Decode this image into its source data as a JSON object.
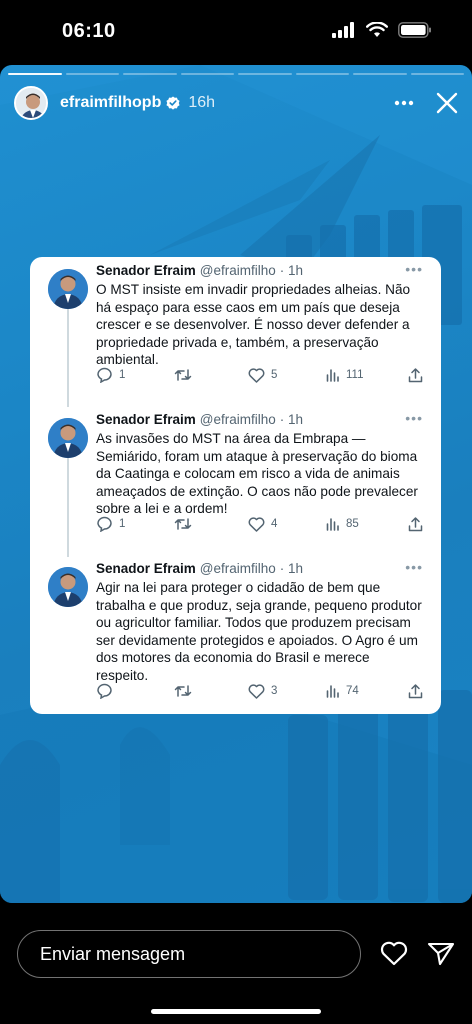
{
  "status": {
    "time": "06:10"
  },
  "story": {
    "username": "efraimfilhopb",
    "time_ago": "16h",
    "segments_total": 8,
    "segments_done": 1
  },
  "tweets": [
    {
      "name": "Senador Efraim",
      "handle": "@efraimfilho",
      "meta": "· 1h",
      "text": "O MST insiste em invadir propriedades alheias. Não há espaço para esse caos em um país que deseja crescer e se desenvolver. É nosso dever defender a propriedade privada e, também, a preservação ambiental.",
      "replies": "1",
      "retweets": "",
      "likes": "5",
      "views": "111"
    },
    {
      "name": "Senador Efraim",
      "handle": "@efraimfilho",
      "meta": "· 1h",
      "text": "As invasões do MST na área da Embrapa — Semiárido, foram um ataque à preservação do bioma da Caatinga e colocam em risco a vida de animais ameaçados de extinção. O caos não pode prevalecer sobre a lei e a ordem!",
      "replies": "1",
      "retweets": "",
      "likes": "4",
      "views": "85"
    },
    {
      "name": "Senador Efraim",
      "handle": "@efraimfilho",
      "meta": "· 1h",
      "text": "Agir na lei para proteger o cidadão de bem que trabalha e que produz, seja grande, pequeno produtor ou agricultor familiar. Todos que produzem precisam ser devidamente protegidos e apoiados. O Agro é um dos motores da economia do Brasil e merece respeito.",
      "replies": "",
      "retweets": "",
      "likes": "3",
      "views": "74"
    }
  ],
  "footer": {
    "message_placeholder": "Enviar mensagem"
  },
  "colors": {
    "story_bg": "#1b86c6",
    "verified": "#ffffff",
    "card": "#ffffff"
  },
  "icons": [
    "signal-icon",
    "wifi-icon",
    "battery-icon",
    "verified-icon",
    "more-icon",
    "close-icon",
    "reply-icon",
    "retweet-icon",
    "like-icon",
    "views-icon",
    "share-icon",
    "heart-icon",
    "send-icon"
  ]
}
